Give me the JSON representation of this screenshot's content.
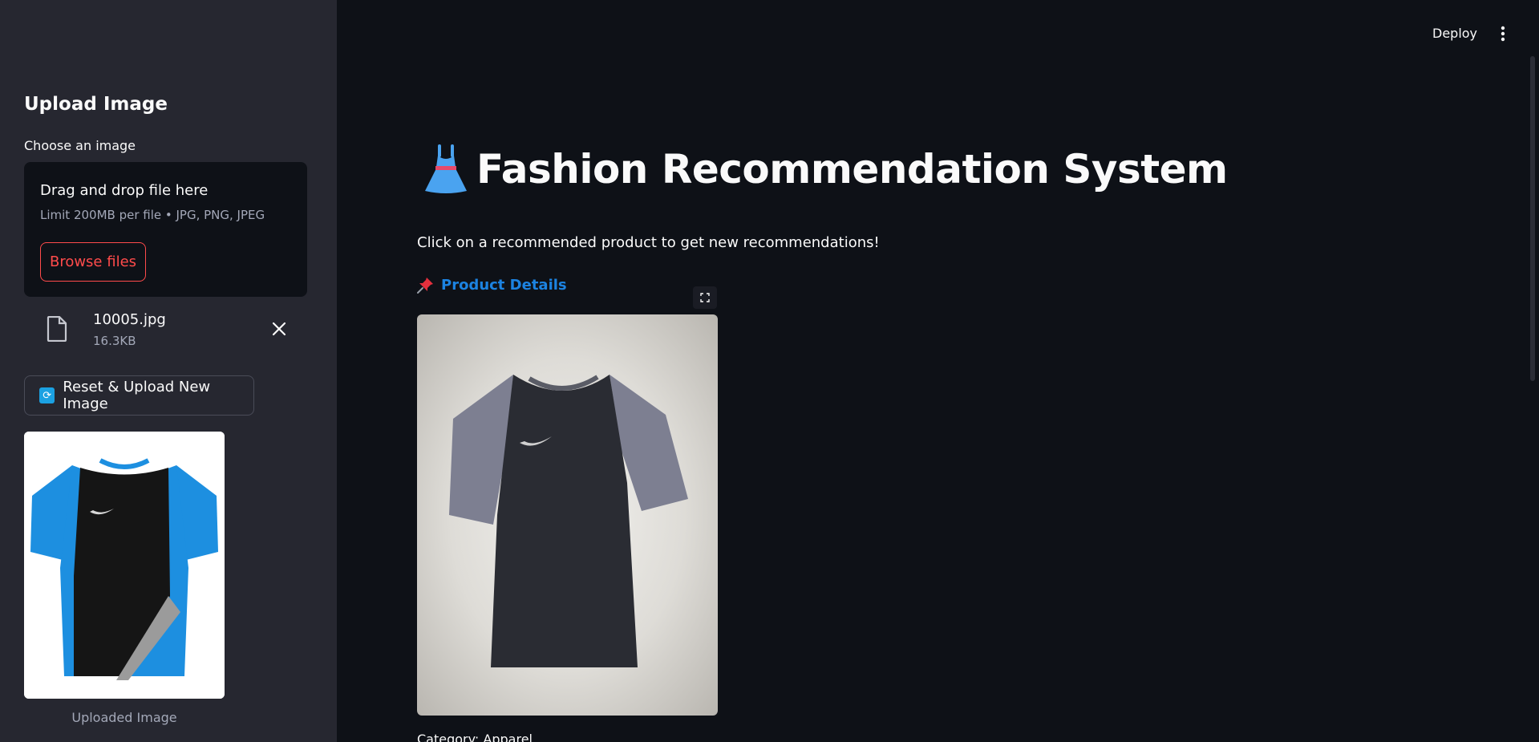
{
  "sidebar": {
    "title": "Upload Image",
    "uploader_label": "Choose an image",
    "dropzone_title": "Drag and drop file here",
    "dropzone_limit": "Limit 200MB per file • JPG, PNG, JPEG",
    "browse_label": "Browse files",
    "file": {
      "name": "10005.jpg",
      "size": "16.3KB"
    },
    "reset_label": "Reset & Upload New Image",
    "uploaded_caption": "Uploaded Image"
  },
  "header": {
    "deploy_label": "Deploy"
  },
  "main": {
    "title": "Fashion Recommendation System",
    "subtitle": "Click on a recommended product to get new recommendations!",
    "section_title": "Product Details",
    "cut_off_text": "Category: Apparel"
  },
  "colors": {
    "background": "#0e1117",
    "sidebar": "#262730",
    "accent_red": "#ff4b4b",
    "link_blue": "#1c83e1"
  }
}
